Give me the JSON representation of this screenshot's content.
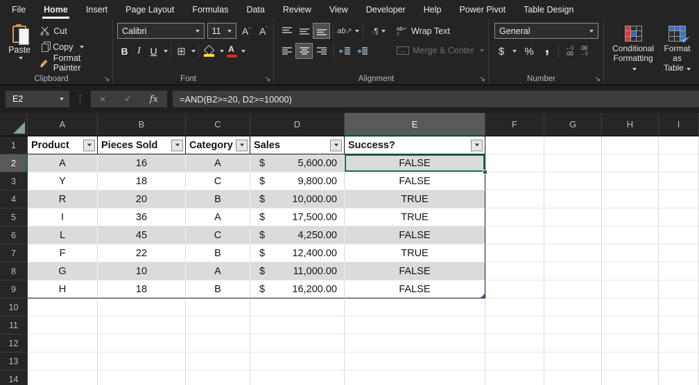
{
  "ribbon": {
    "tabs": [
      {
        "label": "File",
        "active": false
      },
      {
        "label": "Home",
        "active": true
      },
      {
        "label": "Insert",
        "active": false
      },
      {
        "label": "Page Layout",
        "active": false
      },
      {
        "label": "Formulas",
        "active": false
      },
      {
        "label": "Data",
        "active": false
      },
      {
        "label": "Review",
        "active": false
      },
      {
        "label": "View",
        "active": false
      },
      {
        "label": "Developer",
        "active": false
      },
      {
        "label": "Help",
        "active": false
      },
      {
        "label": "Power Pivot",
        "active": false
      },
      {
        "label": "Table Design",
        "active": false
      }
    ],
    "clipboard": {
      "label": "Clipboard",
      "paste": "Paste",
      "cut": "Cut",
      "copy": "Copy",
      "format_painter": "Format Painter"
    },
    "font": {
      "label": "Font",
      "font_name": "Calibri",
      "font_size": "11",
      "bold": "B",
      "italic": "I",
      "underline": "U"
    },
    "alignment": {
      "label": "Alignment",
      "wrap_text": "Wrap Text",
      "merge_center": "Merge & Center"
    },
    "number": {
      "label": "Number",
      "format": "General",
      "currency": "$",
      "percent": "%",
      "comma": ","
    },
    "styles": {
      "conditional_formatting_1": "Conditional",
      "conditional_formatting_2": "Formatting",
      "format_as_table_1": "Format as",
      "format_as_table_2": "Table"
    }
  },
  "icons": {
    "launcher": "↘",
    "dots": "⋮",
    "cancel": "×",
    "enter": "✓",
    "fx": "fx",
    "grow_font": "A",
    "grow_mark": "^",
    "shrink_font": "A",
    "shrink_mark": "ˇ",
    "borders_grid": "⊞",
    "wrap_ab": "ab",
    "wrap_arrow": "↵",
    "wrap_c": "c",
    "merge_arrows": "↔",
    "orientation_ab": "ab",
    "orientation_arrow": "↗",
    "direction_mark": "›",
    "paragraph": "¶",
    "inc_dec_top": "←0",
    "inc_dec_bot": ".00",
    "dec_dec_top": ".00",
    "dec_dec_bot": "→0",
    "fontcolor_letter": "A"
  },
  "formula_bar": {
    "cell_ref": "E2",
    "formula": "=AND(B2>=20, D2>=10000)"
  },
  "sheet": {
    "column_headers": [
      "A",
      "B",
      "C",
      "D",
      "E",
      "F",
      "G",
      "H",
      "I"
    ],
    "row_numbers": [
      "1",
      "2",
      "3",
      "4",
      "5",
      "6",
      "7",
      "8",
      "9",
      "10",
      "11",
      "12",
      "13",
      "14"
    ],
    "selected": {
      "cell": "E2",
      "column": "E",
      "row": 2
    },
    "table": {
      "headers": [
        "Product",
        "Pieces Sold",
        "Category",
        "Sales",
        "Success?"
      ],
      "currency_symbol": "$",
      "rows": [
        [
          "A",
          "16",
          "A",
          "5,600.00",
          "FALSE"
        ],
        [
          "Y",
          "18",
          "C",
          "9,800.00",
          "FALSE"
        ],
        [
          "R",
          "20",
          "B",
          "10,000.00",
          "TRUE"
        ],
        [
          "I",
          "36",
          "A",
          "17,500.00",
          "TRUE"
        ],
        [
          "L",
          "45",
          "C",
          "4,250.00",
          "FALSE"
        ],
        [
          "F",
          "22",
          "B",
          "12,400.00",
          "TRUE"
        ],
        [
          "G",
          "10",
          "A",
          "11,000.00",
          "FALSE"
        ],
        [
          "H",
          "18",
          "B",
          "16,200.00",
          "FALSE"
        ]
      ]
    }
  },
  "colors": {
    "accent_green": "#1e7145",
    "selected_header_bg": "#595959",
    "banded_row": "#dbdbdb",
    "fill_yellow": "#fde802",
    "font_red": "#e02d1f",
    "table_handle_blue": "#44619e",
    "ribbon_bg": "#242424"
  }
}
